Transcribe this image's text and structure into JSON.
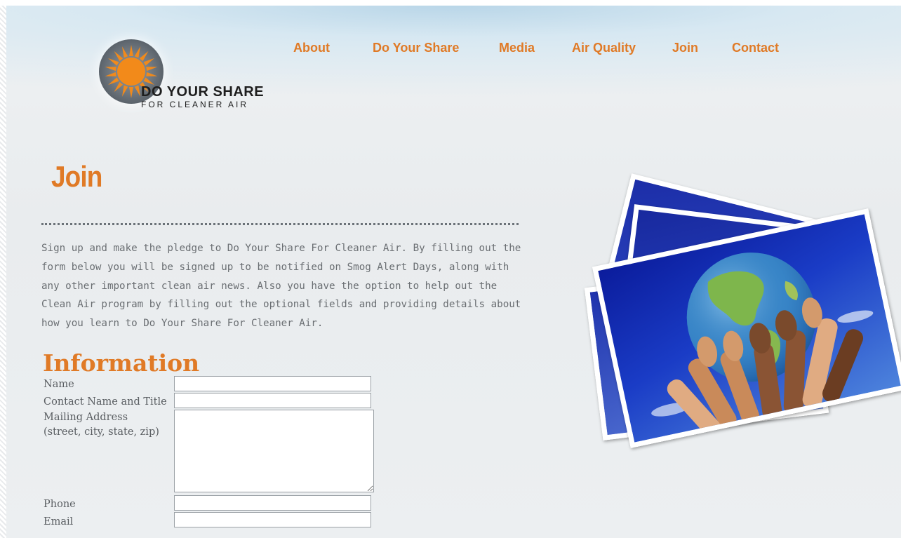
{
  "logo": {
    "line1": "DO YOUR SHARE",
    "line2": "FOR CLEANER AIR",
    "icon": "sun-icon"
  },
  "nav": {
    "items": [
      {
        "label": "About"
      },
      {
        "label": "Do Your Share"
      },
      {
        "label": "Media"
      },
      {
        "label": "Air Quality"
      },
      {
        "label": "Join"
      },
      {
        "label": "Contact"
      }
    ]
  },
  "page": {
    "title": "Join",
    "intro": "Sign up and make the pledge to Do Your Share For Cleaner Air. By filling out the form below you will be signed up to be notified on Smog Alert Days, along with any other important clean air news. Also you have the option to help out the Clean Air program by filling out the optional fields and providing details about how you learn to Do Your Share For Cleaner Air."
  },
  "form": {
    "section_title": "Information",
    "name_label": "Name",
    "contact_label": "Contact Name and Title",
    "address_label_1": "Mailing Address",
    "address_label_2": "(street, city, state, zip)",
    "phone_label": "Phone",
    "email_label": "Email",
    "name_value": "",
    "contact_value": "",
    "address_value": "",
    "phone_value": "",
    "email_value": ""
  },
  "colors": {
    "accent": "#e07a26",
    "body_text": "#6a6e72",
    "photo_blue": "#1a2fa6"
  }
}
